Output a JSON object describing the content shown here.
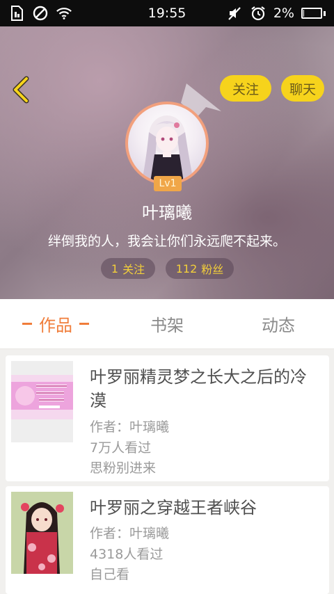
{
  "status_bar": {
    "time": "19:55",
    "battery_text": "2%",
    "battery_level": 0.05,
    "icons_left": [
      "sim-icon",
      "no-disturb-icon",
      "wifi-icon"
    ],
    "icons_right": [
      "mute-icon",
      "alarm-icon",
      "battery-icon"
    ]
  },
  "header": {
    "follow_label": "关注",
    "chat_label": "聊天",
    "level": "Lv1",
    "name": "叶璃曦",
    "bio": "绊倒我的人，我会让你们永远爬不起来。",
    "following_count": "1",
    "following_label": "关注",
    "fans_count": "112",
    "fans_label": "粉丝"
  },
  "tabs": [
    {
      "label": "作品",
      "active": true
    },
    {
      "label": "书架",
      "active": false
    },
    {
      "label": "动态",
      "active": false
    }
  ],
  "works": [
    {
      "title": "叶罗丽精灵梦之长大之后的冷漠",
      "author": "作者：叶璃曦",
      "views": "7万人看过",
      "desc": "思粉别进来"
    },
    {
      "title": "叶罗丽之穿越王者峡谷",
      "author": "作者：叶璃曦",
      "views": "4318人看过",
      "desc": "自己看"
    }
  ],
  "colors": {
    "accent": "#f07d3a",
    "button_yellow": "#f6d31c",
    "stat_text": "#f3cf3a",
    "level_badge": "#f0a648"
  }
}
